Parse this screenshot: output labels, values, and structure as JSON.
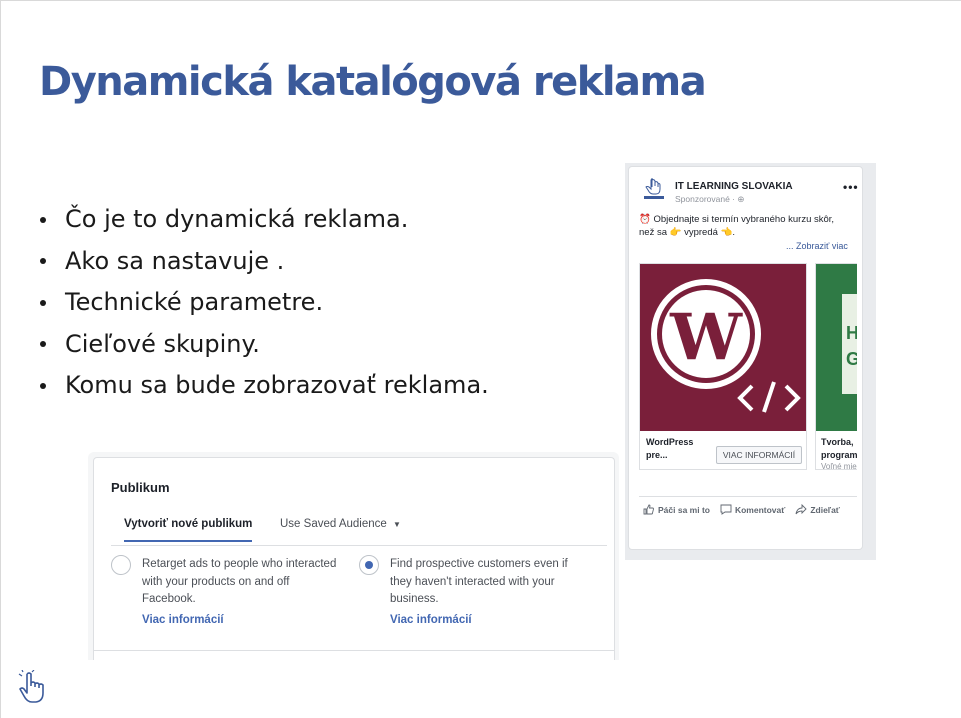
{
  "slide": {
    "title": "Dynamická katalógová reklama",
    "bullets": [
      "Čo je to dynamická reklama.",
      "Ako sa nastavuje .",
      "Technické parametre.",
      "Cieľové skupiny.",
      "Komu sa bude zobrazovať reklama."
    ]
  },
  "fb_ad": {
    "page_name": "IT LEARNING SLOVAKIA",
    "sponsored": "Sponzorované · ⊕",
    "text_line1": "⏰ Objednajte si termín vybraného kurzu skôr,",
    "text_line2": "než sa 👉 vypredá 👈.",
    "see_more": "... Zobraziť viac",
    "card1_title_line1": "WordPress",
    "card1_title_line2": "pre...",
    "card1_button": "VIAC INFORMÁCIÍ",
    "card2_title_line1": "Tvorba, ",
    "card2_title_line2": "program",
    "card2_sub": "Voľné mie",
    "card2_img_text": "H G",
    "like": "Páči sa mi to",
    "comment": "Komentovať",
    "share": "Zdieľať"
  },
  "audience": {
    "title": "Publikum",
    "tab_create": "Vytvoriť nové publikum",
    "tab_saved": "Use Saved Audience",
    "option1_text": "Retarget ads to people who interacted with your products on and off Facebook.",
    "option1_link": "Viac informácií",
    "option2_text": "Find prospective customers even if they haven't interacted with your business.",
    "option2_link": "Viac informácií",
    "selected_option": 2
  },
  "colors": {
    "title": "#3b5a9a",
    "fb_blue": "#4267b2",
    "wp_card": "#7a1f3a",
    "green_card": "#2f7a45"
  }
}
